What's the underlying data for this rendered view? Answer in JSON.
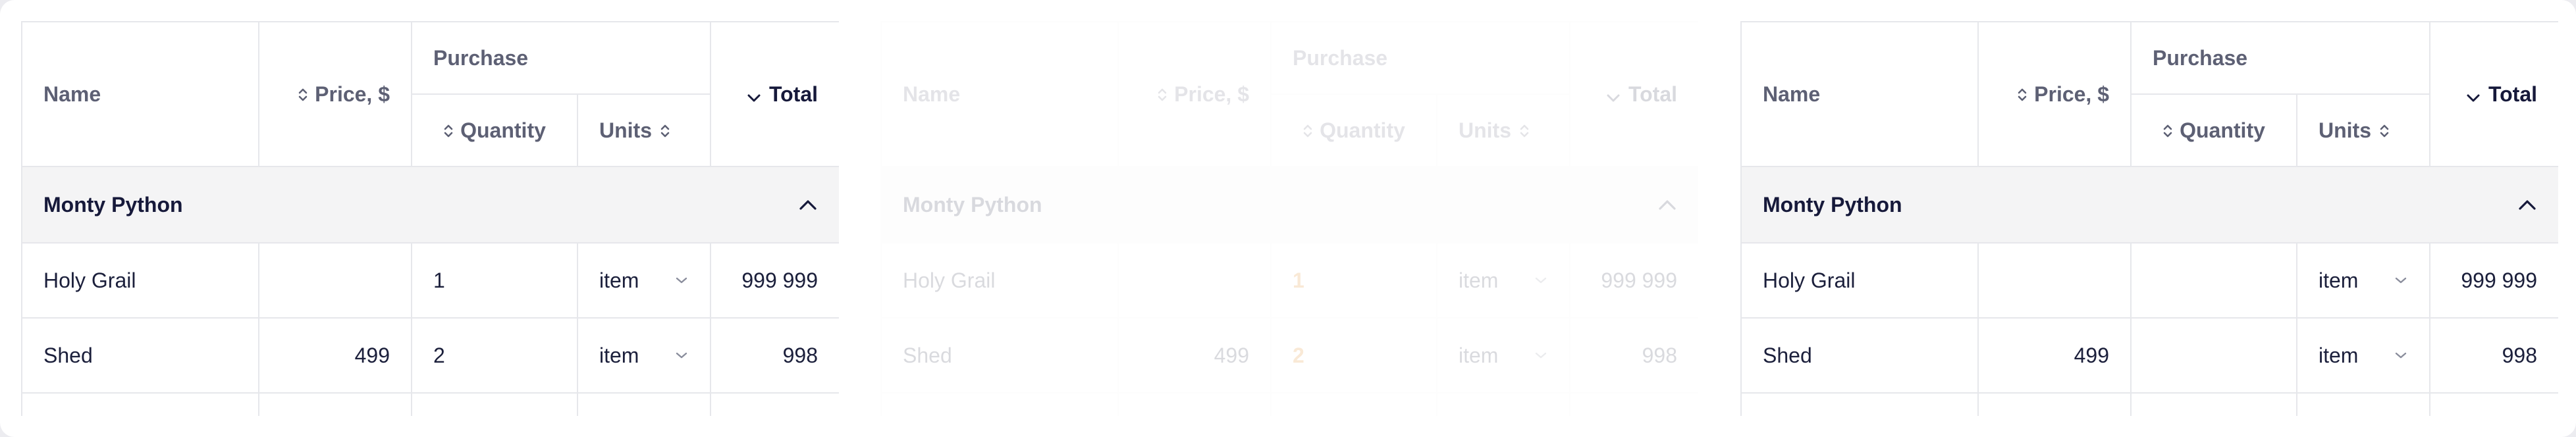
{
  "columns": {
    "name": "Name",
    "price": "Price, $",
    "purchase": "Purchase",
    "quantity": "Quantity",
    "units": "Units",
    "total": "Total"
  },
  "group": {
    "label": "Monty Python"
  },
  "rows": [
    {
      "name": "Holy Grail",
      "price": "",
      "quantity": "1",
      "unit": "item",
      "total": "999 999"
    },
    {
      "name": "Shed",
      "price": "499",
      "quantity": "2",
      "unit": "item",
      "total": "998"
    }
  ],
  "colors": {
    "accent_quantity": "#e07a0b",
    "header_text": "#5d6074",
    "body_text": "#1b1f3b",
    "group_bg": "#f4f4f5",
    "border": "#e6e7eb"
  },
  "icons": {
    "sort": "sort-updown-icon",
    "sort_desc": "chevron-down-icon",
    "collapse": "chevron-up-icon",
    "dropdown": "chevron-down-icon"
  }
}
